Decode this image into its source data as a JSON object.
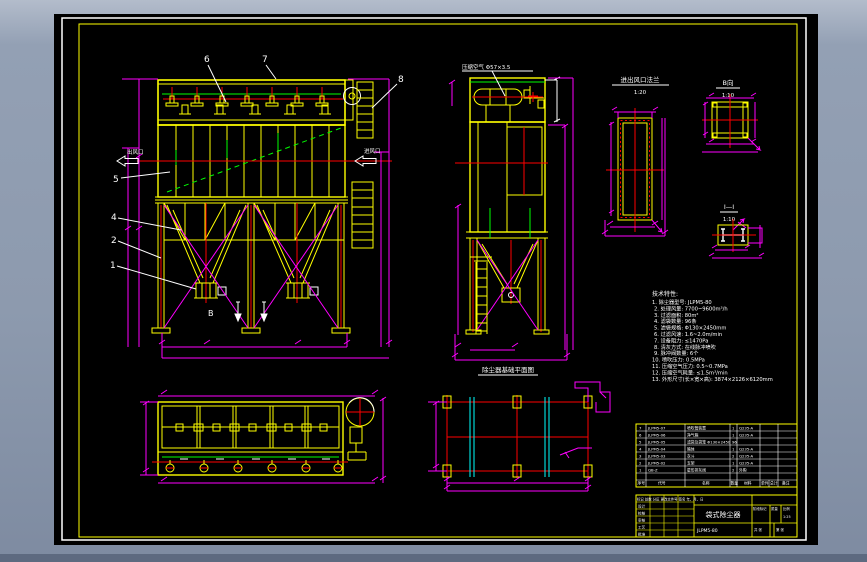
{
  "window": {
    "type": "cad-drawing-viewport",
    "surround_color": "#8d9aae",
    "canvas_color": "#000000"
  },
  "palette": {
    "yellow": "#ffff00",
    "red": "#ff0000",
    "green": "#00ff00",
    "magenta": "#ff00ff",
    "cyan": "#00ffff",
    "white": "#ffffff"
  },
  "callouts": {
    "n1": "1",
    "n2": "2",
    "n4": "4",
    "n5": "5",
    "n6": "6",
    "n7": "7",
    "n8": "8",
    "b": "B"
  },
  "flow_labels": {
    "outlet": "出风口",
    "inlet": "进风口"
  },
  "annotations": {
    "compressed_air": "压缩空气 Φ57×3.5"
  },
  "views": {
    "flange": {
      "title": "进出风口法兰",
      "scale": "1:20"
    },
    "b_view": {
      "title": "B向",
      "scale": "1:10"
    },
    "section": {
      "title": "I—I",
      "scale": "1:10"
    },
    "plan": {
      "title": "除尘器基础平面图"
    }
  },
  "notes": {
    "heading": "技术特性:",
    "lines": [
      "1. 除尘器型号: JLPM5-80",
      "2. 处理风量: 7700~9600m³/h",
      "3. 过滤面积: 80m²",
      "4. 滤袋数量: 96条",
      "5. 滤袋规格: Φ130×2450mm",
      "6. 过滤风速: 1.6~2.0m/min",
      "7. 设备阻力: ≤1470Pa",
      "8. 清灰方式: 在线脉冲喷吹",
      "9. 脉冲阀数量: 6个",
      "10. 喷吹压力: 0.5MPa",
      "11. 压缩空气压力: 0.5~0.7MPa",
      "12. 压缩空气耗量: ≤1.5m³/min",
      "13. 外形尺寸(长×宽×高): 3874×2126×6120mm"
    ]
  },
  "bom": {
    "headers": {
      "no": "序号",
      "code": "代号",
      "name": "名称",
      "qty": "数量",
      "material": "材料",
      "weight": "重量",
      "single": "单件",
      "total": "总计",
      "remark": "备注"
    },
    "rows": [
      {
        "no": "7",
        "code": "JLPM5-07",
        "name": "喷吹管装置",
        "qty": "1",
        "material": "Q235-A",
        "remark": ""
      },
      {
        "no": "6",
        "code": "JLPM5-06",
        "name": "净气箱",
        "qty": "1",
        "material": "Q235-A",
        "remark": ""
      },
      {
        "no": "5",
        "code": "JLPM5-05",
        "name": "滤袋及袋笼 Φ130×2450",
        "qty": "96",
        "material": "",
        "remark": ""
      },
      {
        "no": "4",
        "code": "JLPM5-04",
        "name": "箱体",
        "qty": "1",
        "material": "Q235-A",
        "remark": ""
      },
      {
        "no": "3",
        "code": "JLPM5-03",
        "name": "灰斗",
        "qty": "2",
        "material": "Q235-A",
        "remark": ""
      },
      {
        "no": "2",
        "code": "JLPM5-02",
        "name": "支架",
        "qty": "1",
        "material": "Q235-A",
        "remark": ""
      },
      {
        "no": "1",
        "code": "QB-Z",
        "name": "星形排灰阀",
        "qty": "2",
        "material": "",
        "remark": "外购"
      }
    ]
  },
  "title_block": {
    "title": "袋式除尘器",
    "drawing_no": "JLPM5-80",
    "mark_header": "标记 处数 分区 更改文件号 签名 年、月、日",
    "sign_rows": [
      "设计",
      "校核",
      "审核",
      "工艺",
      "批准"
    ],
    "stage_label": "阶段标记",
    "mass_label": "质量",
    "scale_label": "比例",
    "scale_value": "1:25",
    "sheet_total": "共 张",
    "sheet_no": "第 张"
  }
}
